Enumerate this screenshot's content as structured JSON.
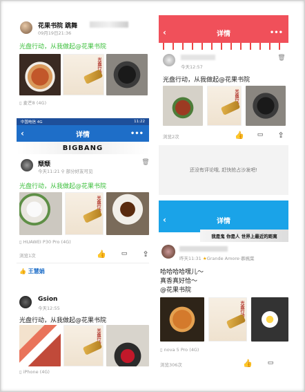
{
  "post1": {
    "name": "花果书院 跳舞",
    "date": "09月19日21:36",
    "text": "光盘行动，从我做起@花果书院",
    "device": "麦芒8 (4G)"
  },
  "post2": {
    "status_left": "中国电信 4G",
    "status_right": "11:22",
    "title": "详情",
    "big_text": "BIGBANG",
    "name": "颓颓",
    "time": "今天11:21",
    "visibility": "部分好友可见",
    "text": "光盘行动，从我做起@花果书院",
    "device": "HUAWEI P30 Pro (4G)",
    "views": "浏览1次",
    "like_user": "王慧娟"
  },
  "post3": {
    "name": "Gsion",
    "time": "今天12:55",
    "text": "光盘行动，从我做起@花果书院",
    "device": "iPhone (4G)"
  },
  "post4": {
    "title": "详情",
    "time": "今天12:57",
    "text": "光盘行动，从我做起@花果书院",
    "views": "浏览2次",
    "empty_comment": "还没有评论哦, 赶快抢占沙发吧!"
  },
  "post5": {
    "title": "详情",
    "banner_text": "我是鬼 你是人 世界上最近的距离",
    "time": "昨天11:31",
    "badge": "Grande Amore·慕楓葉",
    "line1": "哈哈哈哈嘿儿～",
    "line2": "真香真好恰～",
    "line3": "@花果书院",
    "device": "nova 5 Pro (4G)",
    "views": "浏览306次"
  },
  "poster_text": "光盘行动",
  "colors": {
    "red": "#f0505a",
    "blue": "#1e6ec8",
    "green": "#3cbf3c"
  }
}
